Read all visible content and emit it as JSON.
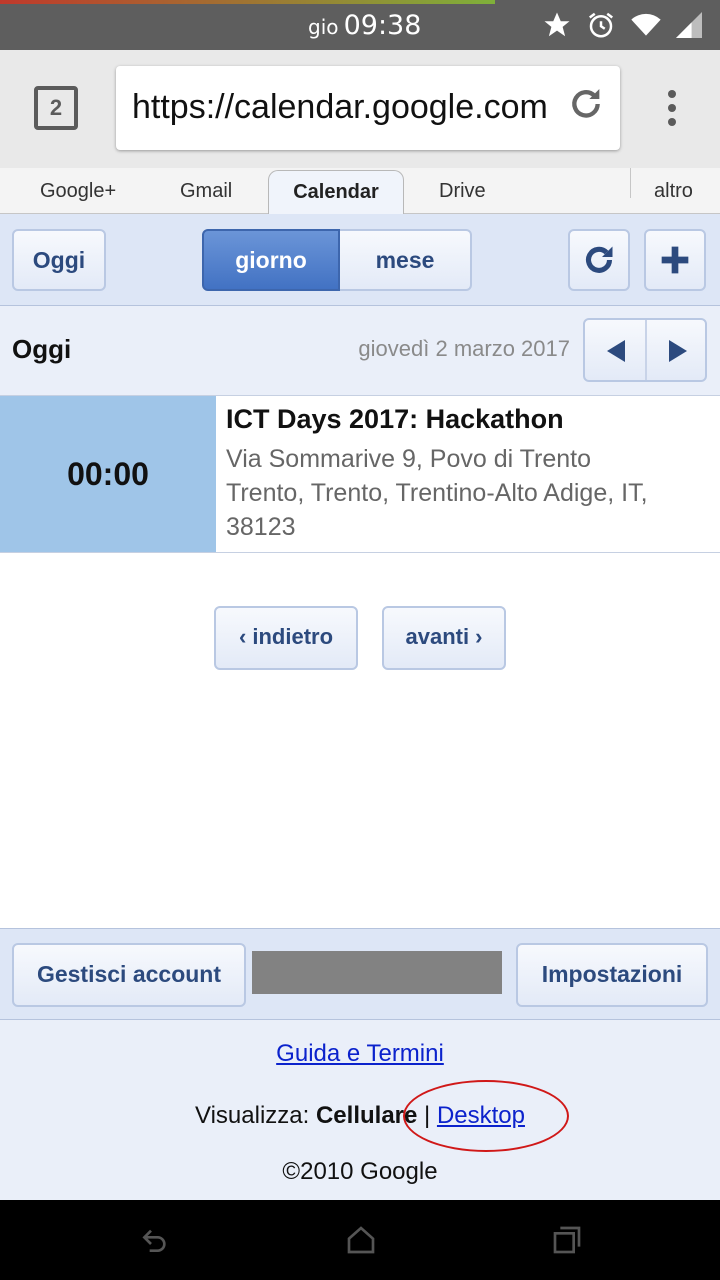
{
  "status_bar": {
    "day": "gio",
    "time": "09:38"
  },
  "browser": {
    "tab_count": "2",
    "url": "https://calendar.google.com"
  },
  "google_nav": {
    "items": [
      "Google+",
      "Gmail",
      "Calendar",
      "Drive",
      "altro"
    ],
    "active": "Calendar"
  },
  "toolbar": {
    "today_label": "Oggi",
    "day_label": "giorno",
    "month_label": "mese",
    "refresh_icon": "refresh-icon",
    "add_icon": "plus-icon"
  },
  "date_row": {
    "heading": "Oggi",
    "date": "giovedì 2 marzo 2017"
  },
  "event": {
    "time": "00:00",
    "title": "ICT Days 2017: Hackathon",
    "location_line1": "Via Sommarive 9, Povo di Trento",
    "location_line2": "Trento, Trento, Trentino-Alto Adige, IT, 38123"
  },
  "pager": {
    "back": "‹ indietro",
    "next": "avanti ›"
  },
  "footer_bar": {
    "account": "Gestisci account",
    "settings": "Impostazioni"
  },
  "footer": {
    "guide": "Guida e Termini",
    "view_prefix": "Visualizza:",
    "view_mobile": "Cellulare",
    "view_sep": "|",
    "view_desktop": "Desktop",
    "copyright": "©2010 Google"
  },
  "colors": {
    "accent": "#4272c3",
    "toolbar_bg": "#dde6f6",
    "event_time_bg": "#9fc5e8",
    "annotation_circle": "#d01818"
  }
}
